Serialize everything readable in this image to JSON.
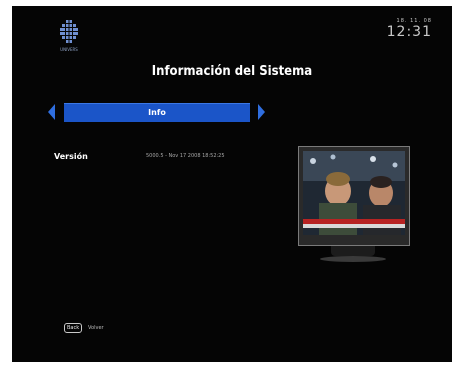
{
  "brand": {
    "logo_text": "UNIVERS",
    "accent_color": "#1b55c8",
    "logo_icon": "grid-globe-logo"
  },
  "clock": {
    "date": "18. 11. 08",
    "time": "12:31"
  },
  "page": {
    "title": "Información del Sistema"
  },
  "tabs": {
    "active_label": "Info",
    "prev_icon": "arrow-left-icon",
    "next_icon": "arrow-right-icon"
  },
  "info": {
    "version_label": "Versión",
    "version_value": "5000.5 - Nov 17 2008 18:52:25"
  },
  "footer": {
    "back_key": "Back",
    "back_label": "Volver"
  }
}
